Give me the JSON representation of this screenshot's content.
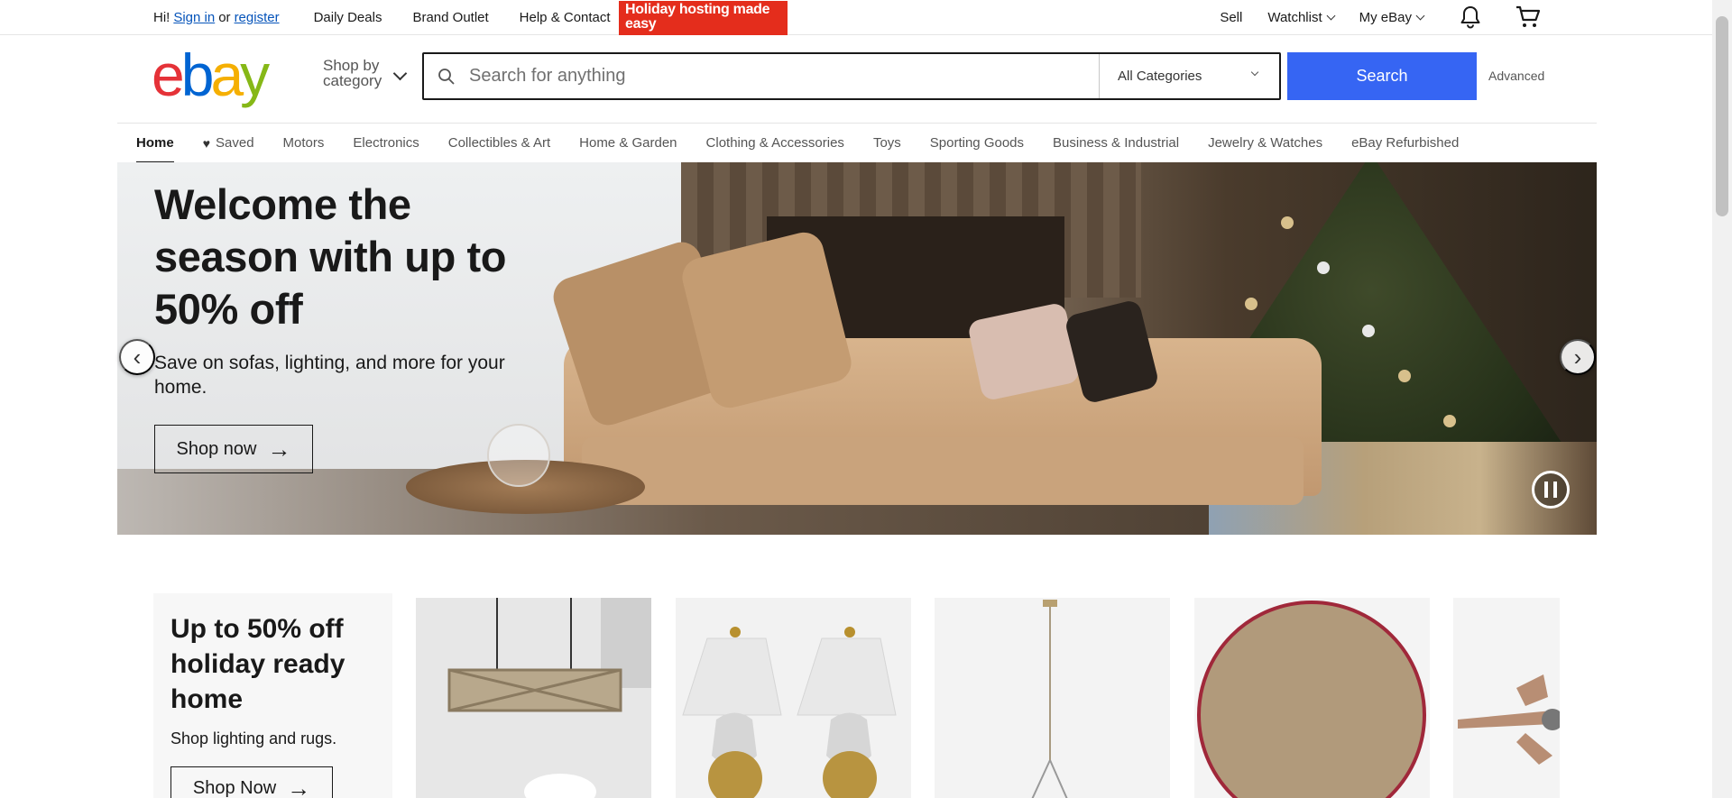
{
  "topbar": {
    "greeting": "Hi!",
    "sign_in": "Sign in",
    "or": "or",
    "register": "register",
    "links": [
      "Daily Deals",
      "Brand Outlet",
      "Help & Contact"
    ],
    "promo_banner": "Holiday hosting made easy",
    "right": {
      "sell": "Sell",
      "watchlist": "Watchlist",
      "my_ebay": "My eBay"
    }
  },
  "header": {
    "logo": {
      "e": "e",
      "b": "b",
      "a": "a",
      "y": "y"
    },
    "shop_by_category": "Shop by category",
    "search_placeholder": "Search for anything",
    "category_select": "All Categories",
    "search_button": "Search",
    "advanced": "Advanced"
  },
  "nav": {
    "items": [
      {
        "label": "Home",
        "active": true
      },
      {
        "label": "Saved"
      },
      {
        "label": "Motors"
      },
      {
        "label": "Electronics"
      },
      {
        "label": "Collectibles & Art"
      },
      {
        "label": "Home & Garden"
      },
      {
        "label": "Clothing & Accessories"
      },
      {
        "label": "Toys"
      },
      {
        "label": "Sporting Goods"
      },
      {
        "label": "Business & Industrial"
      },
      {
        "label": "Jewelry & Watches"
      },
      {
        "label": "eBay Refurbished"
      }
    ]
  },
  "hero": {
    "title": "Welcome the season with up to 50% off",
    "subtitle": "Save on sofas, lighting, and more for your home.",
    "button": "Shop now"
  },
  "promo_card": {
    "title": "Up to 50% off holiday ready home",
    "subtitle": "Shop lighting and rugs.",
    "button": "Shop Now"
  },
  "icons": {
    "search": "search-icon",
    "bell": "bell-icon",
    "cart": "cart-icon",
    "heart": "heart-icon"
  },
  "colors": {
    "search_button": "#3665f3",
    "promo_banner": "#e42d1c",
    "link": "#0654ba"
  }
}
